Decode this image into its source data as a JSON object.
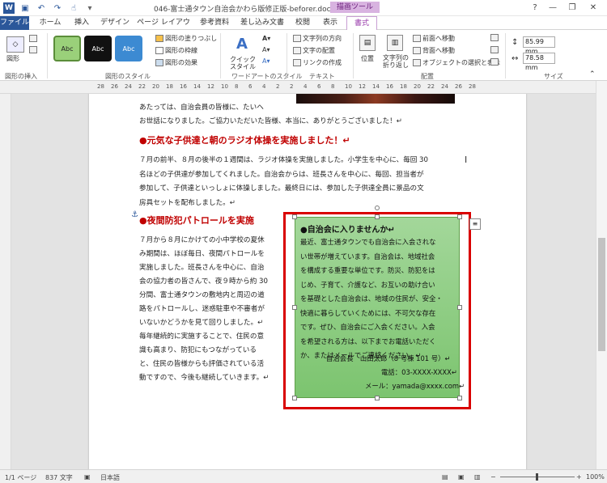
{
  "titlebar": {
    "doc_title": "046-富士通タウン自治会かわら版修正版-beforer.docx - Word",
    "context_label": "描画ツール",
    "help": "?",
    "minimize": "—",
    "restore": "❐",
    "close": "✕"
  },
  "tabs": [
    "ファイル",
    "ホーム",
    "挿入",
    "デザイン",
    "ページ レイアウト",
    "参考資料",
    "差し込み文書",
    "校閲",
    "表示",
    "書式"
  ],
  "ribbon": {
    "insert_shapes": {
      "shapes_label": "図形",
      "group": "図形の挿入"
    },
    "shape_styles": {
      "thumbs": [
        "Abc",
        "Abc",
        "Abc"
      ],
      "fill": "図形の塗りつぶし",
      "outline": "図形の枠線",
      "effects": "図形の効果",
      "group": "図形のスタイル"
    },
    "wordart": {
      "quick_styles": "クイック スタイル",
      "group": "ワードアートのスタイル"
    },
    "text": {
      "direction": "文字列の方向",
      "align": "文字の配置",
      "link": "リンクの作成",
      "group": "テキスト"
    },
    "arrange": {
      "position": "位置",
      "wrap": "文字列の折り返し",
      "forward": "前面へ移動",
      "backward": "背面へ移動",
      "selection": "オブジェクトの選択と表示",
      "group": "配置"
    },
    "size": {
      "height": "85.99 mm",
      "width": "78.58 mm",
      "group": "サイズ"
    }
  },
  "ruler": [
    "28",
    "26",
    "24",
    "22",
    "20",
    "18",
    "16",
    "14",
    "12",
    "10",
    "8",
    "6",
    "4",
    "2",
    "2",
    "4",
    "6",
    "8",
    "10",
    "12",
    "14",
    "16",
    "18",
    "20",
    "22",
    "24",
    "26",
    "28"
  ],
  "document": {
    "para1": [
      "あたっては、自治会員の皆様に、たいへ",
      "お世話になりました。ご協力いただいた皆様、本当に、ありがとうございました！↵"
    ],
    "heading1": "●元気な子供達と朝のラジオ体操を実施しました！↵",
    "para2": [
      "７月の前半、８月の後半の１週間は、ラジオ体操を実施しました。小学生を中心に、毎回 30",
      "名ほどの子供達が参加してくれました。自治会からは、班長さんを中心に、毎回、担当者が",
      "参加して、子供達といっしょに体操しました。最終日には、参加した子供達全員に景品の文",
      "房具セットを配布しました。↵"
    ],
    "heading2": "●夜間防犯パトロールを実施",
    "para3": [
      "７月から８月にかけての小中学校の夏休",
      "み期間は、ほぼ毎日、夜間パトロールを",
      "実施しました。班長さんを中心に、自治",
      "会の協力者の皆さんで、夜９時から約 30",
      "分間、富士通タウンの敷地内と周辺の道",
      "路をパトロールし、迷惑駐車や不審者が",
      "いないかどうかを見て回りしました。↵",
      "毎年継続的に実施することで、住民の意",
      "識も高まり、防犯にもつながっている",
      "と、住民の皆様からも評価されている活",
      "動ですので、今後も継続していきます。↵"
    ]
  },
  "textbox": {
    "title": "●自治会に入りませんか↵",
    "lines": [
      "最近、富士通タウンでも自治会に入会されな",
      "い世帯が増えています。自治会は、地域社会",
      "を構成する重要な単位です。防災、防犯をは",
      "じめ、子育て、介護など、お互いの助け合い",
      "を基礎とした自治会は、地域の住民が、安全・",
      "快適に暮らしていくためには、不可欠な存在",
      "です。ぜひ、自治会にご入会ください。入会",
      "を希望される方は、以下までお電話いただく",
      "か、またはメールでご連絡ください。↵"
    ],
    "contact": [
      "自治会長　山田太郎（8 号棟 101 号）↵",
      "電話：03-XXXX-XXXX↵",
      "メール：yamada@xxxx.com↵"
    ]
  },
  "statusbar": {
    "page": "1/1 ページ",
    "words": "837 文字",
    "lang": "日本語",
    "zoom": "100%"
  },
  "colors": {
    "accent": "#2b579a",
    "context": "#9b3fad",
    "heading": "#c00000",
    "frame": "#d90000",
    "box_fill": "#8dcc7f"
  }
}
